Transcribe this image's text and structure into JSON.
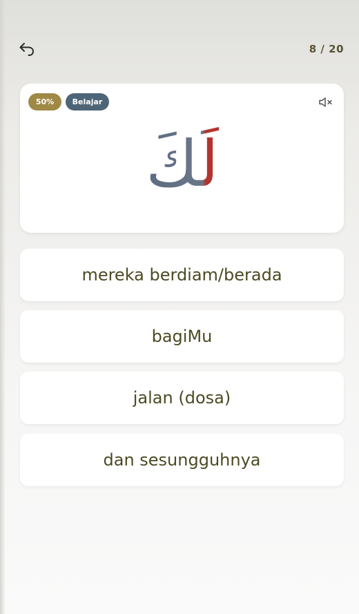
{
  "header": {
    "back_icon": "undo-arrow-icon",
    "progress": "8 / 20"
  },
  "card": {
    "percent_badge": "50%",
    "mode_badge": "Belajar",
    "mute_icon": "speaker-muted-icon",
    "arabic_word": "لَكَ",
    "colors": {
      "base_letter": "#5c6b80",
      "highlight_letter": "#b3342f"
    }
  },
  "options": [
    {
      "label": "mereka berdiam/berada"
    },
    {
      "label": "bagiMu"
    },
    {
      "label": "jalan (dosa)"
    },
    {
      "label": "dan sesungguhnya"
    }
  ],
  "colors": {
    "percent_badge_bg": "#a08846",
    "mode_badge_bg": "#4e6577",
    "option_text": "#4c4a22"
  }
}
